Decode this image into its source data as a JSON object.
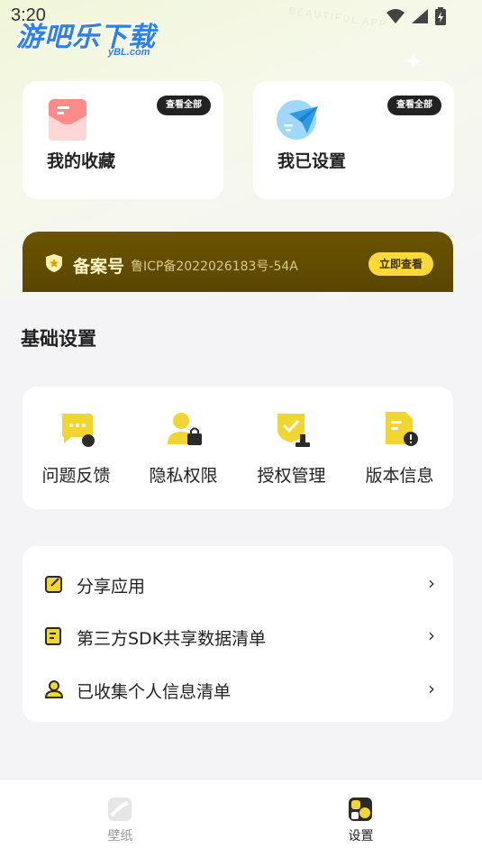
{
  "status_bar": {
    "time": "3:20"
  },
  "watermark": {
    "text": "游吧乐下载",
    "sub": "yBL.com"
  },
  "background_text": "BEAUTIFUL APP",
  "favorites_card": {
    "title": "我的收藏",
    "view_all": "查看全部"
  },
  "settings_card": {
    "title": "我已设置",
    "view_all": "查看全部"
  },
  "icp": {
    "title": "备案号",
    "number": "鲁ICP备2022026183号-54A",
    "button": "立即查看"
  },
  "basic_settings": {
    "title": "基础设置",
    "items": [
      {
        "label": "问题反馈",
        "icon": "feedback-icon"
      },
      {
        "label": "隐私权限",
        "icon": "privacy-icon"
      },
      {
        "label": "授权管理",
        "icon": "authorization-icon"
      },
      {
        "label": "版本信息",
        "icon": "version-info-icon"
      }
    ]
  },
  "list": {
    "items": [
      {
        "label": "分享应用",
        "icon": "share-icon"
      },
      {
        "label": "第三方SDK共享数据清单",
        "icon": "sdk-list-icon"
      },
      {
        "label": "已收集个人信息清单",
        "icon": "personal-info-icon"
      }
    ]
  },
  "tabs": [
    {
      "label": "壁纸",
      "active": false
    },
    {
      "label": "设置",
      "active": true
    }
  ],
  "colors": {
    "accent": "#ffd83a",
    "banner": "#5a4600",
    "active_tab": "#222222",
    "inactive_tab": "#9a9a9a"
  }
}
